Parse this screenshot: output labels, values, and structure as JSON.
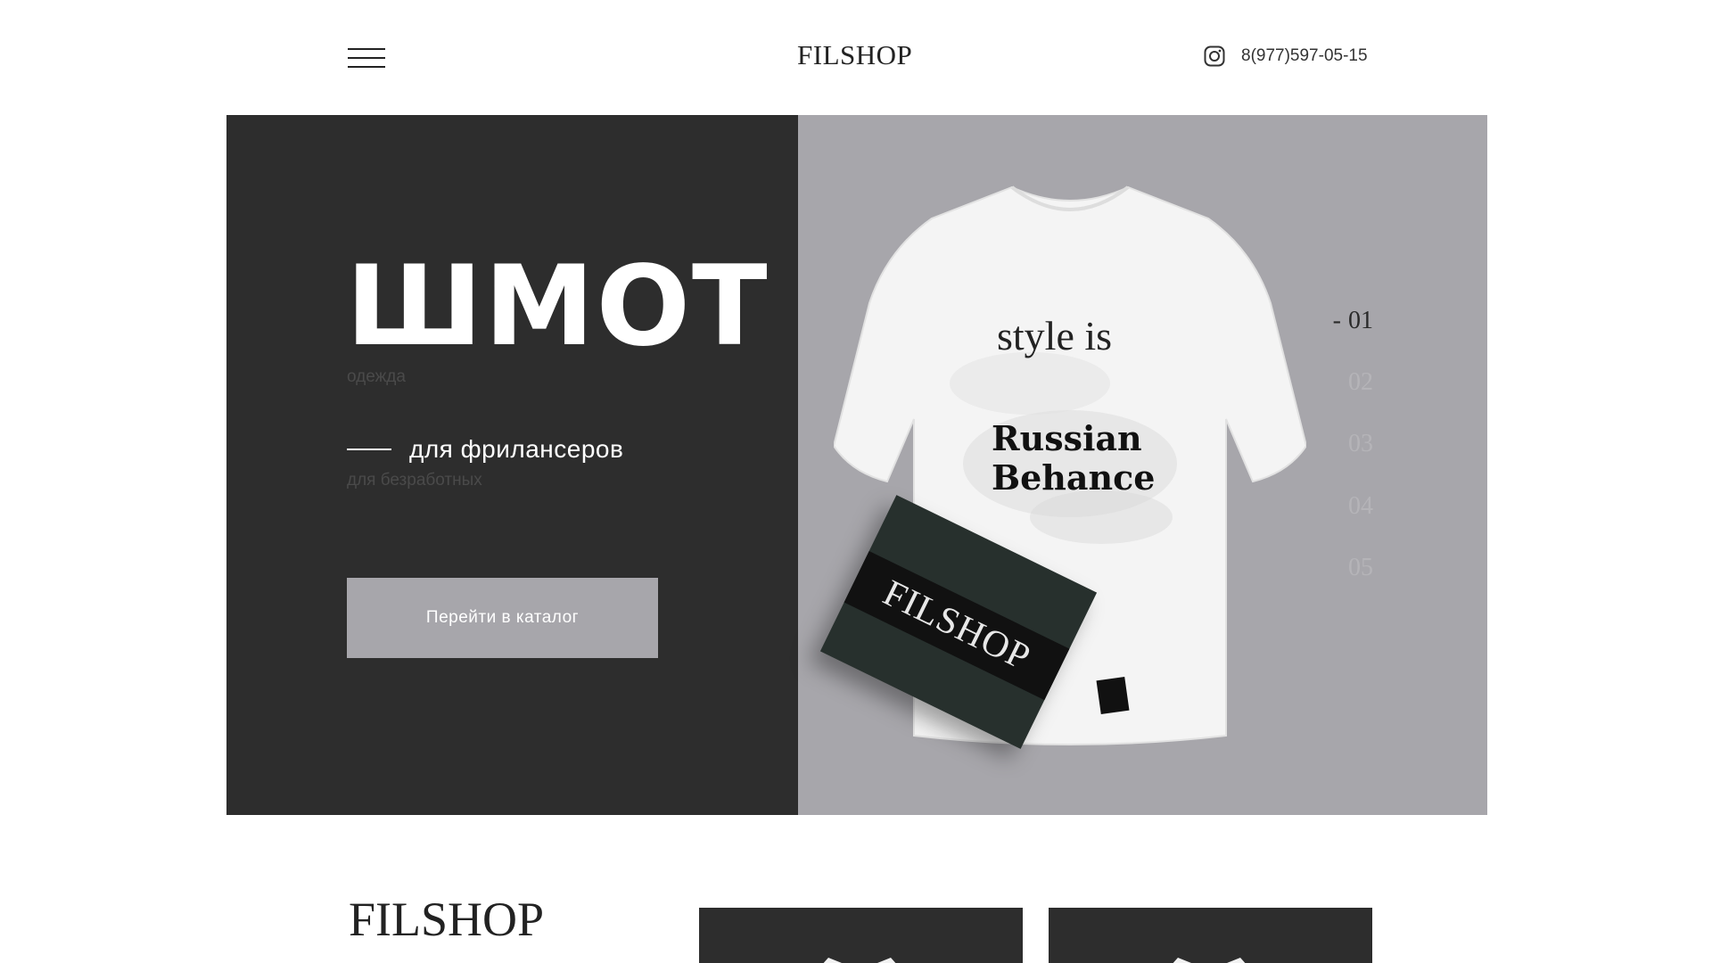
{
  "header": {
    "logo": "FILSHOP",
    "phone": "8(977)597-05-15",
    "icons": {
      "menu": "hamburger-menu-icon",
      "social": "instagram-icon"
    }
  },
  "hero": {
    "title": "ШМОТ",
    "subtitle": "одежда",
    "audience": "для фрилансеров",
    "audience_alt": "для безработных",
    "cta": "Перейти в каталог",
    "slides": [
      "01",
      "02",
      "03",
      "04",
      "05"
    ],
    "active_slide_dash": "-",
    "product_print": {
      "line1": "style is",
      "line2": "Russian Behance"
    },
    "box_brand": "FILSHOP"
  },
  "lower": {
    "logo": "FILSHOP"
  },
  "colors": {
    "dark": "#2d2d2d",
    "gray": "#a7a6ab",
    "white": "#ffffff"
  }
}
